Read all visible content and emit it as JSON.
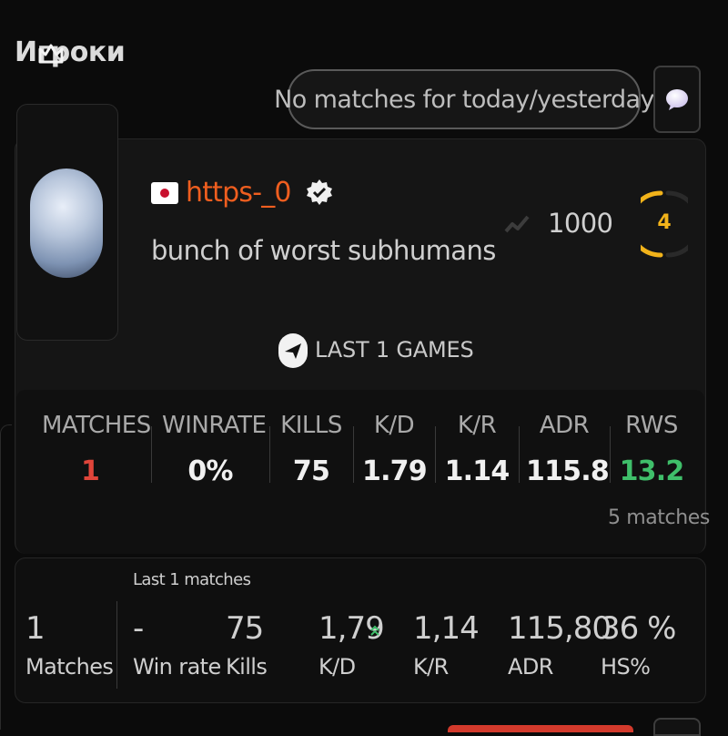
{
  "header": {
    "section_title": "Игроки",
    "no_matches_label": "No matches for today/yesterday"
  },
  "profile": {
    "username": "https-_0",
    "bio": "bunch of worst subhumans",
    "country_flag": "japan-flag",
    "elo": "1000",
    "level": "4",
    "colors": {
      "username": "#ef5e1f",
      "level": "#f2b31a",
      "rws": "#3fbf6a",
      "matches": "#e0453a"
    }
  },
  "last_games": {
    "label": "LAST 1 GAMES",
    "stats": [
      {
        "label": "MATCHES",
        "value": "1"
      },
      {
        "label": "WINRATE",
        "value": "0%"
      },
      {
        "label": "KILLS",
        "value": "75"
      },
      {
        "label": "K/D",
        "value": "1.79"
      },
      {
        "label": "K/R",
        "value": "1.14"
      },
      {
        "label": "ADR",
        "value": "115.8"
      },
      {
        "label": "RWS",
        "value": "13.2"
      }
    ],
    "rws_sub": "5 matches"
  },
  "summary": {
    "caption": "Last 1 matches",
    "items": [
      {
        "value": "1",
        "label": "Matches"
      },
      {
        "value": "-",
        "label": "Win rate"
      },
      {
        "value": "75",
        "label": "Kills"
      },
      {
        "value": "1,79",
        "label": "K/D"
      },
      {
        "value": "1,14",
        "label": "K/R"
      },
      {
        "value": "115,80",
        "label": "ADR"
      },
      {
        "value": "36 %",
        "label": "HS%"
      }
    ]
  }
}
